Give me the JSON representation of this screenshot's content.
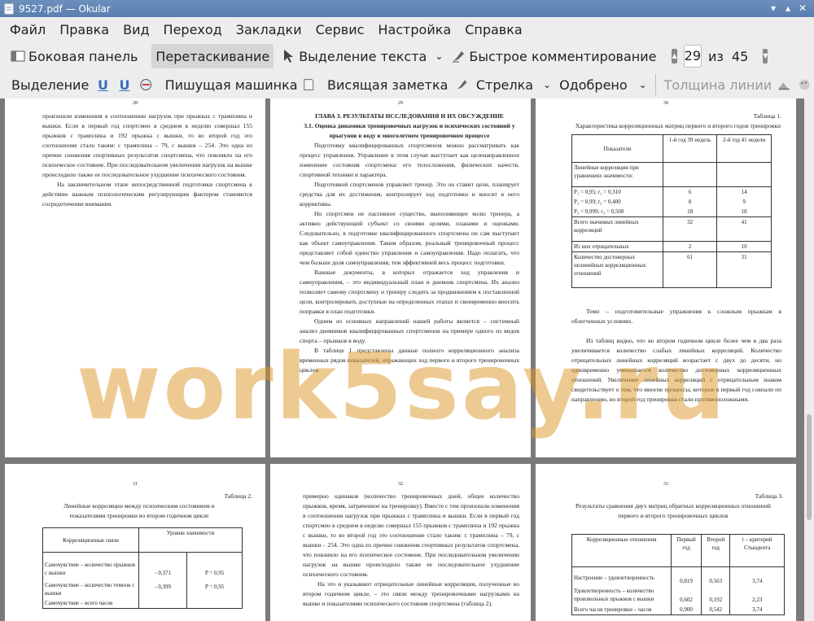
{
  "window": {
    "title": "9527.pdf — Okular"
  },
  "menu": [
    "Файл",
    "Правка",
    "Вид",
    "Переход",
    "Закладки",
    "Сервис",
    "Настройка",
    "Справка"
  ],
  "toolbar1": {
    "sidebar": "Боковая панель",
    "drag": "Перетаскивание",
    "text_select": "Выделение текста",
    "quick_comment": "Быстрое комментирование",
    "page_current": "29",
    "of": "из",
    "page_total": "45"
  },
  "toolbar2": {
    "select": "Выделение",
    "typewriter": "Пишущая машинка",
    "popup_note": "Висящая заметка",
    "arrow": "Стрелка",
    "approved": "Одобрено",
    "line_width": "Толщина линии"
  },
  "watermark": "work5say.ru",
  "pages": {
    "p28": {
      "num": "28",
      "para1": "произошли изменения в соотношении нагрузок при прыжках с трамплина и вышки. Если в первый год спортсмен в среднем в неделю совершал 155 прыжков с трамплина и 192 прыжка с вышки, то во второй год это соотношение стало таким: с трамплина – 79, с вышки – 254. Это одна из причин снижения спортивных результатов спортсмена, что повлияло на его психическое состояние. При последовательном увеличении нагрузок на вышке происходило также ее последовательное ухудшение психического состояния.",
      "para2": "На заключительном этапе непосредственной подготовки спортсмена к действию важным психологическим регулирующим фактором становится сосредоточение внимания."
    },
    "p29": {
      "num": "29",
      "h1": "ГЛАВА 3. РЕЗУЛЬТАТЫ ИССЛЕДОВАНИЯ И ИХ ОБСУЖДЕНИЕ",
      "h2": "3.1. Оценка динамики тренировочных нагрузок и психических состояний у прыгунов в воду в многолетнем тренировочном процессе",
      "para1": "Подготовку квалифицированных спортсменов можно рассматривать как процесс управления. Управление в этом случае выступает как целенаправленное изменение состояния спортсмена: его телосложения, физических качеств, спортивной техники и характера.",
      "para2": "Подготовкой спортсменов управляет тренер. Это он ставит цели, планирует средства для их достижения, контролирует ход подготовки и вносит в него коррективы.",
      "para3": "Но спортсмен не пассивное существо, выполняющее волю тренера, а активно действующий субъект со своими целями, планами и оценками. Следовательно, в подготовке квалифицированного спортсмена он сам выступает как объект самоуправления. Таким образом, реальный тренировочный процесс представляет собой единство управления и самоуправления. Надо полагать, что чем больше доля самоуправления, тем эффективней весь процесс подготовки.",
      "para4": "Важные документы, в которых отражается ход управления и самоуправления, – это индивидуальный план и дневник спортсмена. Их анализ позволяет самому спортсмену и тренеру следить за продвижением к поставленной цели, контролировать доступные на определенных этапах и своевременно вносить поправки в план подготовки.",
      "para5": "Одним из основных направлений нашей работы является – системный анализ дневников квалифицированных спортсменов на примере одного из видов спорта – прыжков в воду.",
      "para6": "В таблице 1 представлены данные полного корреляционного анализа временных рядов показателей, отражающих ход первого и второго тренировочных циклов."
    },
    "p30": {
      "num": "30",
      "table_label": "Таблица 1.",
      "caption": "Характеристика корреляционных матриц первого и второго годов тренировки",
      "col0": "Показатели",
      "col1": "1-й год 39 недель",
      "col2": "2-й год 41 недели",
      "rows": [
        {
          "c0": "Линейные корреляции при уравнениях значимости:",
          "c1": "",
          "c2": ""
        },
        {
          "c0": "P₁ = 0,95;  r₁ = 0,310",
          "c1": "6",
          "c2": "14"
        },
        {
          "c0": "P₂ = 0,99;  r₂ = 0,400",
          "c1": "8",
          "c2": "9"
        },
        {
          "c0": "P₃ = 0,999;  r₃ = 0,500",
          "c1": "18",
          "c2": "18"
        },
        {
          "c0": "Всего значимых линейных корреляций",
          "c1": "32",
          "c2": "41"
        },
        {
          "c0": "Из них отрицательных",
          "c1": "2",
          "c2": "10"
        },
        {
          "c0": "Количество достоверных нелинейных корреляционных отношений",
          "c1": "61",
          "c2": "31"
        }
      ],
      "note": "Темп – подготовительные упражнения к сложным прыжкам в облегченных условиях.",
      "para": "Из таблиц видно, что во втором годичном цикле более чем в два раза увеличивается количество слабых линейных корреляций. Количество отрицательных линейных корреляций возрастает с двух до десяти, но одновременно уменьшается количество достоверных корреляционных отношений. Увеличение линейных корреляций с отрицательным знаком свидетельствует о том, что многие процессы, которые в первый год совпали по направлению, во второй год тренировки стали противоположными."
    },
    "p31": {
      "num": "31",
      "table_label": "Таблица 2.",
      "caption": "Линейные корреляции между психическим состоянием и показателями тренировки во втором годичном цикле",
      "col0": "Корреляционные связи",
      "col1": "Уровни значимости",
      "rows": [
        {
          "c0": "Самочувствие – количество прыжков с вышки",
          "c1": "- 0,371",
          "c2": "P = 0,95"
        },
        {
          "c0": "Самочувствие – количество темпов с вышки",
          "c1": "- 0,399",
          "c2": "P = 0,95"
        },
        {
          "c0": "Самочувствие – всего часов",
          "c1": "",
          "c2": ""
        }
      ]
    },
    "p32": {
      "num": "32",
      "para1": "примерно одинаков (количество тренировочных дней, общее количество прыжков, время, затраченное на тренировку). Вместе с тем произошли изменения в соотношении нагрузок при прыжках с трамплина и вышки. Если в первый год спортсмен в среднем в неделю совершал 155 прыжков с трамплина и 192 прыжка с вышки, то во второй год это соотношение стало таким: с трамплина – 79, с вышки – 254. Это одна из причин снижения спортивных результатов спортсмена, что повлияло на его психическое состояние. При последовательном увеличении нагрузок на вышке происходило также ее последовательное ухудшение психического состояния.",
      "para2": "На это и указывают отрицательные линейные корреляции, полученные во втором годичном цикле, – это связи между тренировочными нагрузками на вышке и показателями психического состояния спортсмена (таблица 2)."
    },
    "p33": {
      "num": "33",
      "table_label": "Таблица 3.",
      "caption": "Результаты сравнения двух матриц обратных корреляционных отношений первого и второго тренировочных циклов",
      "col0": "Корреляционные отношения",
      "col1": "Первый год",
      "col2": "Второй год",
      "col3": "t – критерий Стьюдента",
      "rows": [
        {
          "c0": "Настроение – удовлетворенность",
          "c1": "0,819",
          "c2": "0,563",
          "c3": "3,74"
        },
        {
          "c0": "Удовлетворенность – количество произвольных прыжков с вышки",
          "c1": "0,602",
          "c2": "0,192",
          "c3": "2,23"
        },
        {
          "c0": "Всего часов тренировки – часов",
          "c1": "0,900",
          "c2": "0,542",
          "c3": "3,74"
        }
      ]
    }
  }
}
